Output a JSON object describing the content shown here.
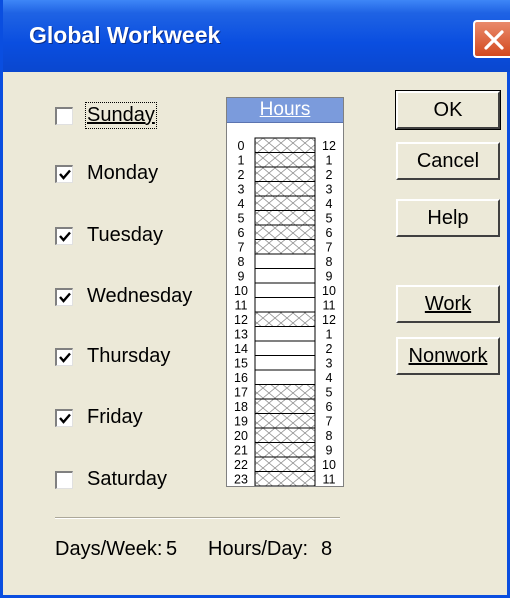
{
  "window": {
    "title": "Global Workweek"
  },
  "days": [
    {
      "label": "Sunday",
      "checked": false
    },
    {
      "label": "Monday",
      "checked": true
    },
    {
      "label": "Tuesday",
      "checked": true
    },
    {
      "label": "Wednesday",
      "checked": true
    },
    {
      "label": "Thursday",
      "checked": true
    },
    {
      "label": "Friday",
      "checked": true
    },
    {
      "label": "Saturday",
      "checked": false
    }
  ],
  "buttons": {
    "ok": "OK",
    "cancel": "Cancel",
    "help": "Help",
    "work": "Work",
    "nonwork": "Nonwork"
  },
  "hours": {
    "header": "Hours",
    "left_labels": [
      "0",
      "1",
      "2",
      "3",
      "4",
      "5",
      "6",
      "7",
      "8",
      "9",
      "10",
      "11",
      "12",
      "13",
      "14",
      "15",
      "16",
      "17",
      "18",
      "19",
      "20",
      "21",
      "22",
      "23"
    ],
    "right_labels": [
      "12",
      "1",
      "2",
      "3",
      "4",
      "5",
      "6",
      "7",
      "8",
      "9",
      "10",
      "11",
      "12",
      "1",
      "2",
      "3",
      "4",
      "5",
      "6",
      "7",
      "8",
      "9",
      "10",
      "11"
    ],
    "nonwork": [
      true,
      true,
      true,
      true,
      true,
      true,
      true,
      true,
      false,
      false,
      false,
      false,
      true,
      false,
      false,
      false,
      false,
      true,
      true,
      true,
      true,
      true,
      true,
      true
    ]
  },
  "summary": {
    "days_label": "Days/Week:",
    "days_value": "5",
    "hours_label": "Hours/Day:",
    "hours_value": "8"
  }
}
